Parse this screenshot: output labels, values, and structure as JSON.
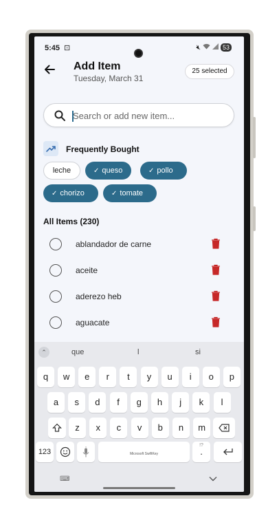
{
  "status": {
    "time": "5:45",
    "battery": "53",
    "icons": [
      "mute-icon",
      "wifi-icon",
      "signal-icon"
    ]
  },
  "header": {
    "title": "Add Item",
    "date": "Tuesday, March 31",
    "selected_badge": "25 selected"
  },
  "search": {
    "placeholder": "Search or add new item...",
    "value": ""
  },
  "frequently_bought": {
    "label": "Frequently Bought",
    "chips": [
      {
        "label": "leche",
        "selected": false
      },
      {
        "label": "queso",
        "selected": true
      },
      {
        "label": "pollo",
        "selected": true
      },
      {
        "label": "chorizo",
        "selected": true
      },
      {
        "label": "tomate",
        "selected": true
      }
    ]
  },
  "all_items": {
    "label": "All Items (230)",
    "items": [
      {
        "name": "ablandador de carne"
      },
      {
        "name": "aceite"
      },
      {
        "name": "aderezo heb"
      },
      {
        "name": "aguacate"
      }
    ]
  },
  "keyboard": {
    "suggestions": [
      "que",
      "l",
      "si"
    ],
    "row1": [
      "q",
      "w",
      "e",
      "r",
      "t",
      "y",
      "u",
      "i",
      "o",
      "p"
    ],
    "row2": [
      "a",
      "s",
      "d",
      "f",
      "g",
      "h",
      "j",
      "k",
      "l"
    ],
    "row3": [
      "z",
      "x",
      "c",
      "v",
      "b",
      "n",
      "m"
    ],
    "numbers_key": "123",
    "space_brand": "Microsoft SwiftKey",
    "period_key": ".",
    "period_alt": "!?",
    "mic_alt": ","
  },
  "colors": {
    "accent": "#2c6b8b",
    "delete": "#c62828",
    "background": "#f4f6fb"
  }
}
